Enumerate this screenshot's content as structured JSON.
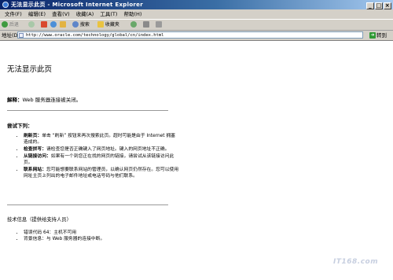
{
  "window": {
    "title": "无法显示此页 - Microsoft Internet Explorer",
    "buttons": [
      "_",
      "□",
      "×"
    ]
  },
  "menu": [
    "文件(F)",
    "编辑(E)",
    "查看(V)",
    "收藏(A)",
    "工具(T)",
    "帮助(H)"
  ],
  "toolbar": {
    "back_label": "后退",
    "search_label": "搜索",
    "favorites_label": "收藏夹"
  },
  "address": {
    "label": "地址(D)",
    "url": "http://www.oracle.com/technology/global/cn/index.html",
    "go_label": "转到"
  },
  "page": {
    "heading": "无法显示此页",
    "cause_label": "解释：",
    "cause_text": "Web 服务器连接被关闭。",
    "try_heading": "尝试下列：",
    "tips": [
      {
        "label": "刷新页：",
        "text": "单击 “刷新” 按钮来再次搜索此页。超时可能是由于 Internet 拥塞造成的。"
      },
      {
        "label": "检查拼写：",
        "text": "请检查您是否正确键入了网页地址。键入的网页地址不正确。"
      },
      {
        "label": "从链接访问：",
        "text": "如果有一个到您正在找的网页的链接，请尝试从该链接访问此页。"
      },
      {
        "label": "联系网站：",
        "text": "您可能想要联系网站的管理员，以确认网页仍然存在。您可以使用网址主页上列出的电子邮件地址或电话号码与他们联系。"
      }
    ],
    "tech_heading": "技术信息（提供给支持人员）",
    "tech_items": [
      "错误代码 64：主机不可用",
      "背景信息：与 Web 服务器的连接中断。"
    ]
  },
  "watermark": "IT168.com",
  "colors": {
    "titlebar_start": "#0a246a",
    "chrome": "#d4d0c8",
    "go_green": "#2f9a34"
  }
}
